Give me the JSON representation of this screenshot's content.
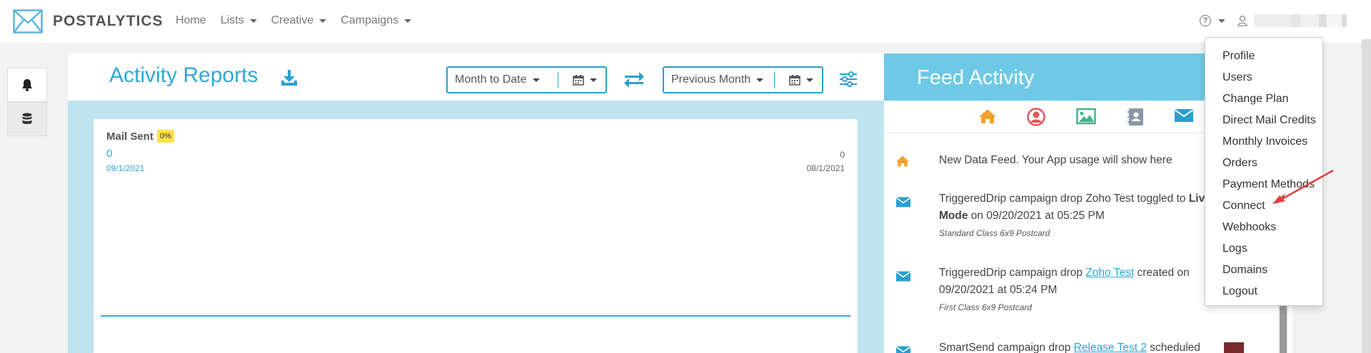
{
  "brand": {
    "name": "POSTALYTICS"
  },
  "nav": {
    "items": [
      {
        "label": "Home",
        "has_caret": false
      },
      {
        "label": "Lists",
        "has_caret": true
      },
      {
        "label": "Creative",
        "has_caret": true
      },
      {
        "label": "Campaigns",
        "has_caret": true
      }
    ],
    "help_icon": "question-circle-icon",
    "user_icon": "user-icon"
  },
  "sidebar": {
    "items": [
      "bell-icon",
      "database-icon"
    ]
  },
  "activity": {
    "title": "Activity Reports",
    "period_primary": "Month to Date",
    "period_compare": "Previous Month",
    "card": {
      "metric_label": "Mail Sent",
      "badge": "0%",
      "current_value": "0",
      "current_date": "09/1/2021",
      "compare_value": "0",
      "compare_date": "08/1/2021"
    }
  },
  "feed": {
    "title": "Feed Activity",
    "tabs": [
      "home-icon",
      "user-circle-icon",
      "image-icon",
      "contact-book-icon",
      "envelope-icon"
    ],
    "items": [
      {
        "icon": "home-icon",
        "text": "New Data Feed. Your App usage will show here"
      },
      {
        "icon": "envelope-icon",
        "text_before": "TriggeredDrip campaign drop Zoho Test toggled to ",
        "bold": "Live Mode",
        "text_after": " on 09/20/2021 at 05:25 PM",
        "sub": "Standard Class 6x9 Postcard"
      },
      {
        "icon": "envelope-icon",
        "text_before": "TriggeredDrip campaign drop ",
        "link": "Zoho Test",
        "text_after": " created on 09/20/2021 at 05:24 PM",
        "sub": "First Class 6x9 Postcard"
      },
      {
        "icon": "envelope-icon",
        "text_before": "SmartSend campaign drop ",
        "link": "Release Test 2",
        "text_after": " scheduled"
      }
    ]
  },
  "user_menu": {
    "items": [
      "Profile",
      "Users",
      "Change Plan",
      "Direct Mail Credits",
      "Monthly Invoices",
      "Orders",
      "Payment Methods",
      "Connect",
      "Webhooks",
      "Logs",
      "Domains",
      "Logout"
    ]
  },
  "colors": {
    "accent": "#30a8d8",
    "feed_header": "#6ec9e6",
    "panel_bg": "#bfe4f0",
    "badge": "#ffe14d",
    "annotation_arrow": "#e04040"
  }
}
